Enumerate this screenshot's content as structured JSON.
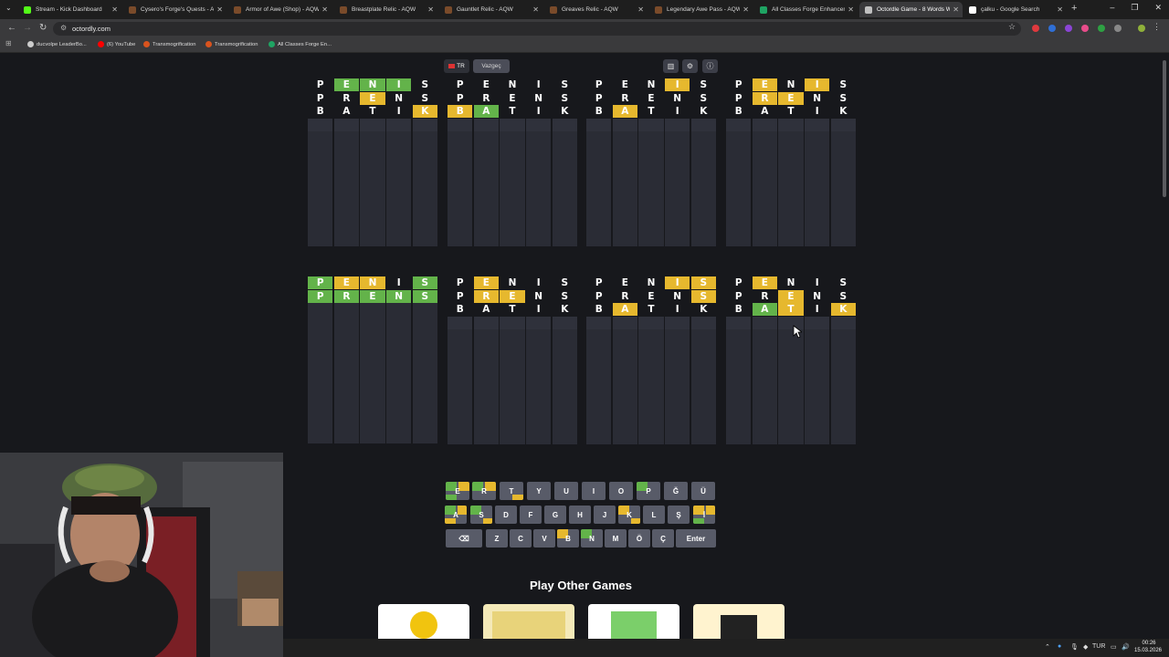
{
  "browser": {
    "tabs": [
      {
        "title": "Stream - Kick Dashboard",
        "icon": "kick-icon",
        "color": "#53fc18"
      },
      {
        "title": "Cysero's Forge's Quests - AQ",
        "icon": "aqw-icon",
        "color": "#7a4b2a"
      },
      {
        "title": "Armor of Awe (Shop) - AQW",
        "icon": "aqw-icon",
        "color": "#7a4b2a"
      },
      {
        "title": "Breastplate Relic - AQW",
        "icon": "aqw-icon",
        "color": "#7a4b2a"
      },
      {
        "title": "Gauntlet Relic - AQW",
        "icon": "aqw-icon",
        "color": "#7a4b2a"
      },
      {
        "title": "Greaves Relic - AQW",
        "icon": "aqw-icon",
        "color": "#7a4b2a"
      },
      {
        "title": "Legendary Awe Pass - AQW",
        "icon": "aqw-icon",
        "color": "#7a4b2a"
      },
      {
        "title": "All Classes Forge Enhanceme",
        "icon": "sheets-icon",
        "color": "#1fa463"
      },
      {
        "title": "Octordle Game - 8 Words Wi",
        "icon": "octordle-icon",
        "color": "#c0c0c0",
        "active": true
      },
      {
        "title": "çalku - Google Search",
        "icon": "google-icon",
        "color": "#ffffff"
      }
    ],
    "url": "octordly.com",
    "bookmarks": [
      {
        "label": "ducvolpe LeaderBo...",
        "color": "#cccccc"
      },
      {
        "label": "(6) YouTube",
        "color": "#ff0000"
      },
      {
        "label": "Transmogrification",
        "color": "#d9531e"
      },
      {
        "label": "Transmogrification",
        "color": "#d9531e"
      },
      {
        "label": "All Classes Forge En...",
        "color": "#1fa463"
      }
    ]
  },
  "toolbar": {
    "lang": "TR",
    "giveup": "Vazgeç",
    "icons": [
      "stats-icon",
      "settings-icon",
      "info-icon"
    ]
  },
  "colors": {
    "green": "#63b34a",
    "yellow": "#e6b82e",
    "key": "#585b68",
    "bg": "#17181c"
  },
  "boards": [
    {
      "rows": [
        [
          [
            "P",
            ""
          ],
          [
            "E",
            "g"
          ],
          [
            "N",
            "g"
          ],
          [
            "I",
            "g"
          ],
          [
            "S",
            ""
          ]
        ],
        [
          [
            "P",
            ""
          ],
          [
            "R",
            ""
          ],
          [
            "E",
            "y"
          ],
          [
            "N",
            ""
          ],
          [
            "S",
            ""
          ]
        ],
        [
          [
            "B",
            ""
          ],
          [
            "A",
            ""
          ],
          [
            "T",
            ""
          ],
          [
            "I",
            ""
          ],
          [
            "K",
            "y"
          ]
        ]
      ]
    },
    {
      "rows": [
        [
          [
            "P",
            ""
          ],
          [
            "E",
            ""
          ],
          [
            "N",
            ""
          ],
          [
            "I",
            ""
          ],
          [
            "S",
            ""
          ]
        ],
        [
          [
            "P",
            ""
          ],
          [
            "R",
            ""
          ],
          [
            "E",
            ""
          ],
          [
            "N",
            ""
          ],
          [
            "S",
            ""
          ]
        ],
        [
          [
            "B",
            "y"
          ],
          [
            "A",
            "g"
          ],
          [
            "T",
            ""
          ],
          [
            "I",
            ""
          ],
          [
            "K",
            ""
          ]
        ]
      ]
    },
    {
      "rows": [
        [
          [
            "P",
            ""
          ],
          [
            "E",
            ""
          ],
          [
            "N",
            ""
          ],
          [
            "I",
            "y"
          ],
          [
            "S",
            ""
          ]
        ],
        [
          [
            "P",
            ""
          ],
          [
            "R",
            ""
          ],
          [
            "E",
            ""
          ],
          [
            "N",
            ""
          ],
          [
            "S",
            ""
          ]
        ],
        [
          [
            "B",
            ""
          ],
          [
            "A",
            "y"
          ],
          [
            "T",
            ""
          ],
          [
            "I",
            ""
          ],
          [
            "K",
            ""
          ]
        ]
      ]
    },
    {
      "rows": [
        [
          [
            "P",
            ""
          ],
          [
            "E",
            "y"
          ],
          [
            "N",
            ""
          ],
          [
            "I",
            "y"
          ],
          [
            "S",
            ""
          ]
        ],
        [
          [
            "P",
            ""
          ],
          [
            "R",
            "y"
          ],
          [
            "E",
            "y"
          ],
          [
            "N",
            ""
          ],
          [
            "S",
            ""
          ]
        ],
        [
          [
            "B",
            ""
          ],
          [
            "A",
            ""
          ],
          [
            "T",
            ""
          ],
          [
            "I",
            ""
          ],
          [
            "K",
            ""
          ]
        ]
      ]
    },
    {
      "rows": [
        [
          [
            "P",
            "g"
          ],
          [
            "E",
            "y"
          ],
          [
            "N",
            "y"
          ],
          [
            "I",
            ""
          ],
          [
            "S",
            "g"
          ]
        ],
        [
          [
            "P",
            "g"
          ],
          [
            "R",
            "g"
          ],
          [
            "E",
            "g"
          ],
          [
            "N",
            "g"
          ],
          [
            "S",
            "g"
          ]
        ]
      ],
      "solved": true
    },
    {
      "rows": [
        [
          [
            "P",
            ""
          ],
          [
            "E",
            "y"
          ],
          [
            "N",
            ""
          ],
          [
            "I",
            ""
          ],
          [
            "S",
            ""
          ]
        ],
        [
          [
            "P",
            ""
          ],
          [
            "R",
            "y"
          ],
          [
            "E",
            "y"
          ],
          [
            "N",
            ""
          ],
          [
            "S",
            ""
          ]
        ],
        [
          [
            "B",
            ""
          ],
          [
            "A",
            ""
          ],
          [
            "T",
            ""
          ],
          [
            "I",
            ""
          ],
          [
            "K",
            ""
          ]
        ]
      ]
    },
    {
      "rows": [
        [
          [
            "P",
            ""
          ],
          [
            "E",
            ""
          ],
          [
            "N",
            ""
          ],
          [
            "I",
            "y"
          ],
          [
            "S",
            "y"
          ]
        ],
        [
          [
            "P",
            ""
          ],
          [
            "R",
            ""
          ],
          [
            "E",
            ""
          ],
          [
            "N",
            ""
          ],
          [
            "S",
            "y"
          ]
        ],
        [
          [
            "B",
            ""
          ],
          [
            "A",
            "y"
          ],
          [
            "T",
            ""
          ],
          [
            "I",
            ""
          ],
          [
            "K",
            ""
          ]
        ]
      ]
    },
    {
      "rows": [
        [
          [
            "P",
            ""
          ],
          [
            "E",
            "y"
          ],
          [
            "N",
            ""
          ],
          [
            "I",
            ""
          ],
          [
            "S",
            ""
          ]
        ],
        [
          [
            "P",
            ""
          ],
          [
            "R",
            ""
          ],
          [
            "E",
            "y"
          ],
          [
            "N",
            ""
          ],
          [
            "S",
            ""
          ]
        ],
        [
          [
            "B",
            ""
          ],
          [
            "A",
            "g"
          ],
          [
            "T",
            "y"
          ],
          [
            "I",
            ""
          ],
          [
            "K",
            "y"
          ]
        ]
      ]
    }
  ],
  "keyboard": {
    "row1": [
      "E",
      "R",
      "T",
      "Y",
      "U",
      "I",
      "O",
      "P",
      "Ğ",
      "Ü"
    ],
    "row2": [
      "A",
      "S",
      "D",
      "F",
      "G",
      "H",
      "J",
      "K",
      "L",
      "Ş",
      "İ"
    ],
    "row3": [
      "⌫",
      "Z",
      "C",
      "V",
      "B",
      "N",
      "M",
      "Ö",
      "Ç",
      "Enter"
    ]
  },
  "other_games": {
    "title": "Play Other Games",
    "cards": [
      "#ffffff",
      "#f4e9b8",
      "#ffffff",
      "#fff3cf"
    ]
  },
  "taskbar": {
    "lang": "TUR",
    "time": "00:26",
    "date": "15.03.2026"
  }
}
